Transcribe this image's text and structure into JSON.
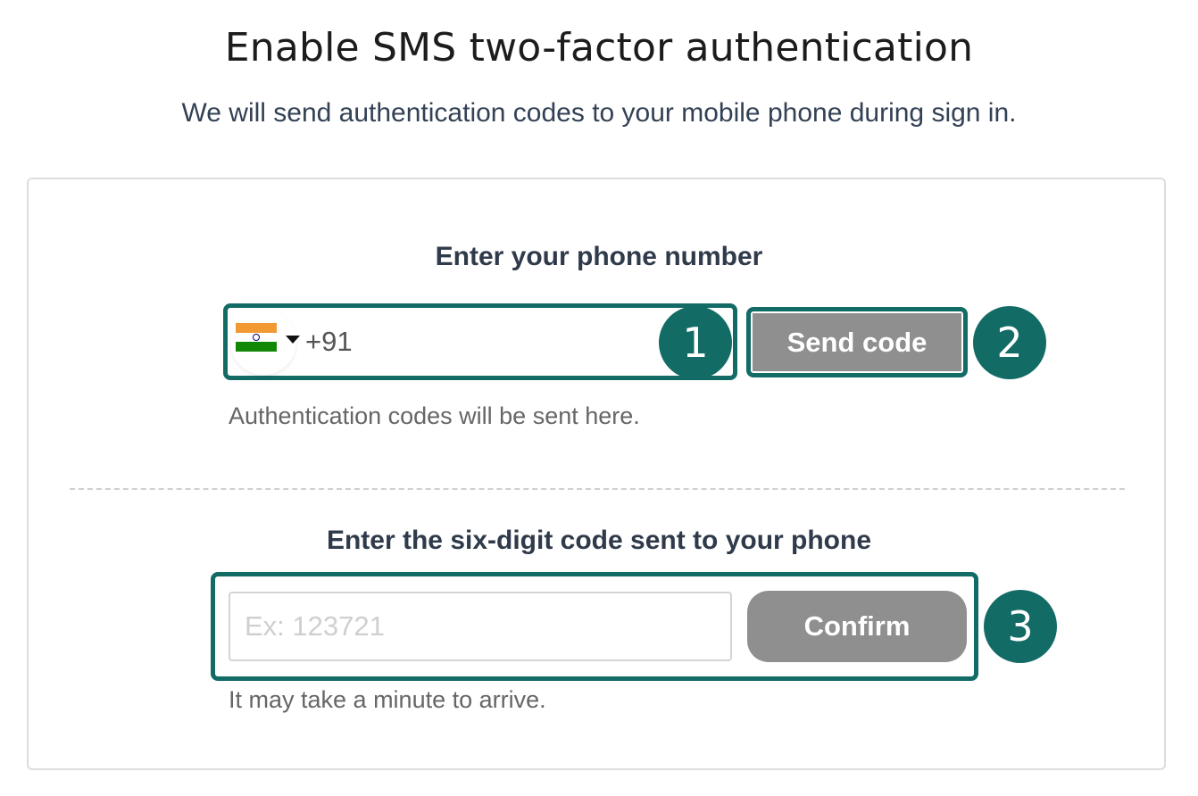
{
  "header": {
    "title": "Enable SMS two-factor authentication",
    "subtitle": "We will send authentication codes to your mobile phone during sign in."
  },
  "phone_section": {
    "heading": "Enter your phone number",
    "country_flag": "india-flag-icon",
    "phone_value": "+91",
    "send_label": "Send code",
    "hint": "Authentication codes will be sent here."
  },
  "code_section": {
    "heading": "Enter the six-digit code sent to your phone",
    "placeholder": "Ex: 123721",
    "confirm_label": "Confirm",
    "hint": "It may take a minute to arrive."
  },
  "annotations": [
    {
      "number": "1"
    },
    {
      "number": "2"
    },
    {
      "number": "3"
    }
  ],
  "colors": {
    "accent": "#136b66",
    "button": "#8f8f8f",
    "heading": "#2f3a4a",
    "hint": "#666666"
  }
}
